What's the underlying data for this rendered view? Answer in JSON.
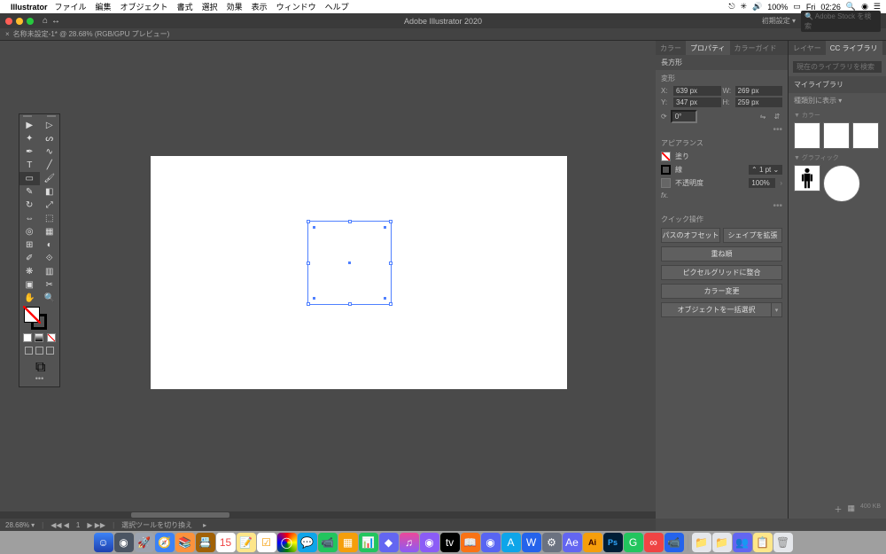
{
  "menubar": {
    "app": "Illustrator",
    "items": [
      "ファイル",
      "編集",
      "オブジェクト",
      "書式",
      "選択",
      "効果",
      "表示",
      "ウィンドウ",
      "ヘルプ"
    ],
    "battery": "100%",
    "day": "Fri",
    "time": "02:26"
  },
  "titlebar": {
    "title": "Adobe Illustrator 2020",
    "mode": "初期設定",
    "stock_placeholder": "Adobe Stock を検索"
  },
  "tab": {
    "name": "名称未設定-1* @ 28.68% (RGB/GPU プレビュー)"
  },
  "status": {
    "zoom": "28.68%",
    "artboard_nav": "1",
    "tool_hint": "選択ツールを切り換え"
  },
  "propPanel": {
    "tabs": [
      "カラー",
      "プロパティ",
      "カラーガイド"
    ],
    "active_tab": 1,
    "shape_name": "長方形",
    "transform_label": "変形",
    "x_label": "X:",
    "x": "639 px",
    "y_label": "Y:",
    "y": "347 px",
    "w_label": "W:",
    "w": "269 px",
    "h_label": "H:",
    "h": "259 px",
    "rotate": "0°",
    "appearance_label": "アピアランス",
    "fill_label": "塗り",
    "stroke_label": "線",
    "stroke_val": "1 pt",
    "opacity_label": "不透明度",
    "opacity_val": "100%",
    "fx_label": "fx.",
    "quick_label": "クイック操作",
    "btn_offset": "パスのオフセット",
    "btn_expand": "シェイプを拡張",
    "btn_arrange": "重ね順",
    "btn_pixel": "ピクセルグリッドに整合",
    "btn_recolor": "カラー変更",
    "btn_select": "オブジェクトを一括選択"
  },
  "libPanel": {
    "tabs": [
      "レイヤー",
      "CC ライブラリ"
    ],
    "active_tab": 1,
    "search_placeholder": "現在のライブラリを検索",
    "title": "マイライブラリ",
    "sort": "種類別に表示",
    "sec_colors": "▼ カラー",
    "sec_graphics": "▼ グラフィック",
    "footer_size": "400 KB"
  }
}
